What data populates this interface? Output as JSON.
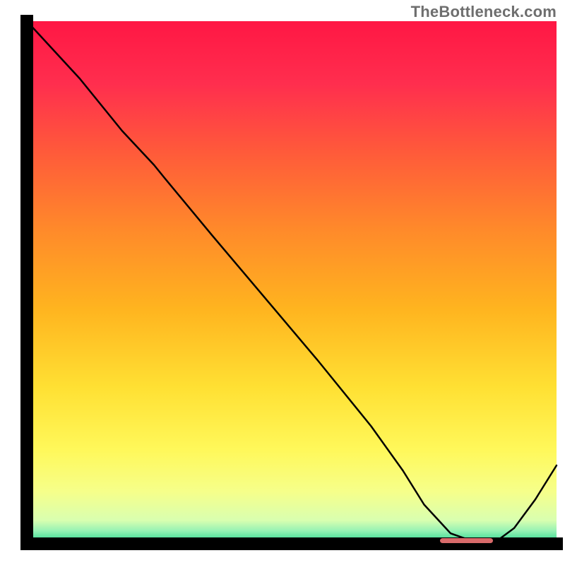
{
  "watermark": "TheBottleneck.com",
  "chart_data": {
    "type": "line",
    "title": "",
    "xlabel": "",
    "ylabel": "",
    "xlim": [
      0,
      100
    ],
    "ylim": [
      0,
      100
    ],
    "grid": false,
    "legend": false,
    "axes_visible": false,
    "background": {
      "type": "vertical-gradient",
      "stops": [
        {
          "pos": 0.0,
          "color": "#ff1744"
        },
        {
          "pos": 0.12,
          "color": "#ff2e4e"
        },
        {
          "pos": 0.25,
          "color": "#ff5a3a"
        },
        {
          "pos": 0.4,
          "color": "#ff8a2a"
        },
        {
          "pos": 0.55,
          "color": "#ffb41f"
        },
        {
          "pos": 0.7,
          "color": "#ffe033"
        },
        {
          "pos": 0.82,
          "color": "#fff85a"
        },
        {
          "pos": 0.9,
          "color": "#f6ff8a"
        },
        {
          "pos": 0.955,
          "color": "#d9ffb0"
        },
        {
          "pos": 0.975,
          "color": "#96f2b4"
        },
        {
          "pos": 1.0,
          "color": "#20d48a"
        }
      ]
    },
    "series": [
      {
        "name": "curve",
        "stroke": "#000000",
        "strokeWidth": 2.5,
        "x": [
          0.0,
          10.0,
          18.0,
          24.0,
          26.0,
          35.0,
          45.0,
          55.0,
          65.0,
          71.0,
          75.0,
          80.0,
          85.0,
          88.0,
          92.0,
          96.0,
          100.0
        ],
        "y": [
          100.0,
          89.0,
          79.0,
          72.5,
          70.0,
          59.0,
          47.0,
          35.0,
          22.5,
          14.0,
          7.5,
          2.0,
          0.2,
          0.0,
          3.0,
          8.5,
          15.0
        ]
      }
    ],
    "marker": {
      "name": "optimal-band",
      "x_from": 78,
      "x_to": 88,
      "y": 0.6,
      "color": "#d86a6a",
      "thickness": 7,
      "cap_radius": 3.5
    }
  }
}
